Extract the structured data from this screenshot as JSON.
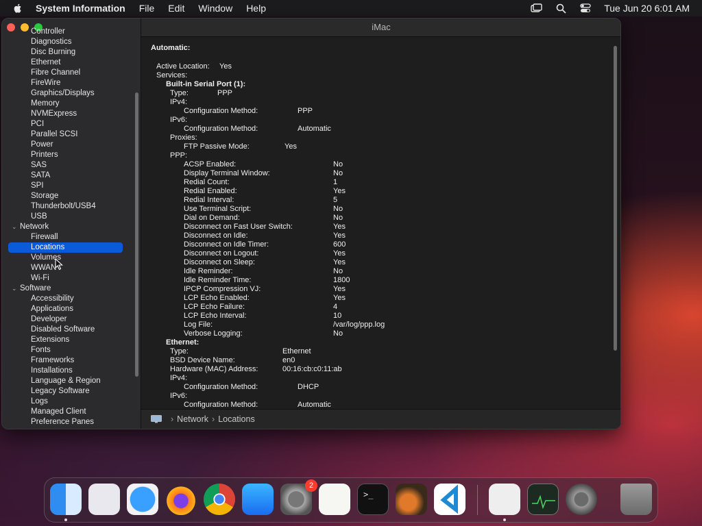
{
  "menubar": {
    "app_name": "System Information",
    "items": [
      "File",
      "Edit",
      "Window",
      "Help"
    ],
    "datetime": "Tue Jun 20  6:01 AM"
  },
  "window": {
    "title": "iMac",
    "sidebar": {
      "items": [
        {
          "label": "Controller",
          "level": "child"
        },
        {
          "label": "Diagnostics",
          "level": "child"
        },
        {
          "label": "Disc Burning",
          "level": "child"
        },
        {
          "label": "Ethernet",
          "level": "child"
        },
        {
          "label": "Fibre Channel",
          "level": "child"
        },
        {
          "label": "FireWire",
          "level": "child"
        },
        {
          "label": "Graphics/Displays",
          "level": "child"
        },
        {
          "label": "Memory",
          "level": "child"
        },
        {
          "label": "NVMExpress",
          "level": "child"
        },
        {
          "label": "PCI",
          "level": "child"
        },
        {
          "label": "Parallel SCSI",
          "level": "child"
        },
        {
          "label": "Power",
          "level": "child"
        },
        {
          "label": "Printers",
          "level": "child"
        },
        {
          "label": "SAS",
          "level": "child"
        },
        {
          "label": "SATA",
          "level": "child"
        },
        {
          "label": "SPI",
          "level": "child"
        },
        {
          "label": "Storage",
          "level": "child"
        },
        {
          "label": "Thunderbolt/USB4",
          "level": "child"
        },
        {
          "label": "USB",
          "level": "child"
        },
        {
          "label": "Network",
          "level": "group"
        },
        {
          "label": "Firewall",
          "level": "child"
        },
        {
          "label": "Locations",
          "level": "child",
          "selected": true
        },
        {
          "label": "Volumes",
          "level": "child"
        },
        {
          "label": "WWAN",
          "level": "child"
        },
        {
          "label": "Wi-Fi",
          "level": "child"
        },
        {
          "label": "Software",
          "level": "group"
        },
        {
          "label": "Accessibility",
          "level": "child"
        },
        {
          "label": "Applications",
          "level": "child"
        },
        {
          "label": "Developer",
          "level": "child"
        },
        {
          "label": "Disabled Software",
          "level": "child"
        },
        {
          "label": "Extensions",
          "level": "child"
        },
        {
          "label": "Fonts",
          "level": "child"
        },
        {
          "label": "Frameworks",
          "level": "child"
        },
        {
          "label": "Installations",
          "level": "child"
        },
        {
          "label": "Language & Region",
          "level": "child"
        },
        {
          "label": "Legacy Software",
          "level": "child"
        },
        {
          "label": "Logs",
          "level": "child"
        },
        {
          "label": "Managed Client",
          "level": "child"
        },
        {
          "label": "Preference Panes",
          "level": "child"
        }
      ]
    },
    "details": {
      "heading": "Automatic:",
      "lines": [
        {
          "indent": 0,
          "label": "Active Location:",
          "value": "Yes",
          "bold": false
        },
        {
          "indent": 0,
          "label": "Services:",
          "value": "",
          "bold": false
        },
        {
          "indent": 1,
          "label": "Built-in Serial Port (1):",
          "value": "",
          "bold": true
        },
        {
          "indent": 2,
          "label": "Type:",
          "value": "PPP",
          "bold": false
        },
        {
          "indent": 2,
          "label": "IPv4:",
          "value": "",
          "bold": false
        },
        {
          "indent": 3,
          "label": "Configuration Method:",
          "value": "PPP",
          "bold": false
        },
        {
          "indent": 2,
          "label": "IPv6:",
          "value": "",
          "bold": false
        },
        {
          "indent": 3,
          "label": "Configuration Method:",
          "value": "Automatic",
          "bold": false
        },
        {
          "indent": 2,
          "label": "Proxies:",
          "value": "",
          "bold": false
        },
        {
          "indent": 3,
          "label": "FTP Passive Mode:",
          "value": "Yes",
          "bold": false
        },
        {
          "indent": 2,
          "label": "PPP:",
          "value": "",
          "bold": false
        },
        {
          "indent": 3,
          "label": "ACSP Enabled:",
          "value": "No",
          "bold": false
        },
        {
          "indent": 3,
          "label": "Display Terminal Window:",
          "value": "No",
          "bold": false
        },
        {
          "indent": 3,
          "label": "Redial Count:",
          "value": "1",
          "bold": false
        },
        {
          "indent": 3,
          "label": "Redial Enabled:",
          "value": "Yes",
          "bold": false
        },
        {
          "indent": 3,
          "label": "Redial Interval:",
          "value": "5",
          "bold": false
        },
        {
          "indent": 3,
          "label": "Use Terminal Script:",
          "value": "No",
          "bold": false
        },
        {
          "indent": 3,
          "label": "Dial on Demand:",
          "value": "No",
          "bold": false
        },
        {
          "indent": 3,
          "label": "Disconnect on Fast User Switch:",
          "value": "Yes",
          "bold": false
        },
        {
          "indent": 3,
          "label": "Disconnect on Idle:",
          "value": "Yes",
          "bold": false
        },
        {
          "indent": 3,
          "label": "Disconnect on Idle Timer:",
          "value": "600",
          "bold": false
        },
        {
          "indent": 3,
          "label": "Disconnect on Logout:",
          "value": "Yes",
          "bold": false
        },
        {
          "indent": 3,
          "label": "Disconnect on Sleep:",
          "value": "Yes",
          "bold": false
        },
        {
          "indent": 3,
          "label": "Idle Reminder:",
          "value": "No",
          "bold": false
        },
        {
          "indent": 3,
          "label": "Idle Reminder Time:",
          "value": "1800",
          "bold": false
        },
        {
          "indent": 3,
          "label": "IPCP Compression VJ:",
          "value": "Yes",
          "bold": false
        },
        {
          "indent": 3,
          "label": "LCP Echo Enabled:",
          "value": "Yes",
          "bold": false
        },
        {
          "indent": 3,
          "label": "LCP Echo Failure:",
          "value": "4",
          "bold": false
        },
        {
          "indent": 3,
          "label": "LCP Echo Interval:",
          "value": "10",
          "bold": false
        },
        {
          "indent": 3,
          "label": "Log File:",
          "value": "/var/log/ppp.log",
          "bold": false
        },
        {
          "indent": 3,
          "label": "Verbose Logging:",
          "value": "No",
          "bold": false
        },
        {
          "indent": 1,
          "label": "Ethernet:",
          "value": "",
          "bold": true
        },
        {
          "indent": 2,
          "label": "Type:",
          "value": "Ethernet",
          "bold": false
        },
        {
          "indent": 2,
          "label": "BSD Device Name:",
          "value": "en0",
          "bold": false
        },
        {
          "indent": 2,
          "label": "Hardware (MAC) Address:",
          "value": "00:16:cb:c0:11:ab",
          "bold": false
        },
        {
          "indent": 2,
          "label": "IPv4:",
          "value": "",
          "bold": false
        },
        {
          "indent": 3,
          "label": "Configuration Method:",
          "value": "DHCP",
          "bold": false
        },
        {
          "indent": 2,
          "label": "IPv6:",
          "value": "",
          "bold": false
        },
        {
          "indent": 3,
          "label": "Configuration Method:",
          "value": "Automatic",
          "bold": false
        }
      ]
    },
    "pathbar": {
      "crumbs": [
        "Network",
        "Locations"
      ]
    }
  },
  "dock": {
    "apps": [
      {
        "name": "Finder",
        "icon": "finder-icon",
        "running": true
      },
      {
        "name": "Launchpad",
        "icon": "launchpad-icon",
        "running": false
      },
      {
        "name": "Safari",
        "icon": "safari-icon",
        "running": false
      },
      {
        "name": "Firefox",
        "icon": "firefox-icon",
        "running": false
      },
      {
        "name": "Chrome",
        "icon": "chrome-icon",
        "running": false
      },
      {
        "name": "App Store",
        "icon": "app-store-icon",
        "running": false
      },
      {
        "name": "System Preferences",
        "icon": "system-preferences-icon",
        "running": false,
        "badge": "2"
      },
      {
        "name": "TextEdit",
        "icon": "textedit-icon",
        "running": false
      },
      {
        "name": "Terminal",
        "icon": "terminal-icon",
        "running": false
      },
      {
        "name": "GarageBand",
        "icon": "garageband-icon",
        "running": false
      },
      {
        "name": "VS Code",
        "icon": "vscode-icon",
        "running": false
      },
      {
        "name": "System Information",
        "icon": "system-information-icon",
        "running": true
      },
      {
        "name": "Activity Monitor",
        "icon": "activity-monitor-icon",
        "running": false
      },
      {
        "name": "System Settings",
        "icon": "system-settings-icon",
        "running": false
      },
      {
        "name": "Trash",
        "icon": "trash-icon",
        "running": false
      }
    ]
  },
  "colors": {
    "selection": "#0a5ad9",
    "close": "#ff5f57",
    "minimize": "#febc2e",
    "zoom": "#28c840",
    "badge": "#ff3b30"
  }
}
